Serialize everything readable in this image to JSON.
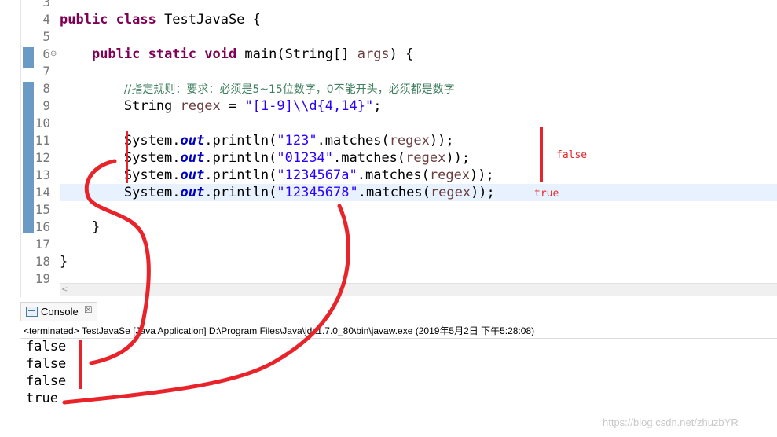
{
  "editor": {
    "lines": [
      {
        "num": "3"
      },
      {
        "num": "4",
        "code": [
          {
            "t": "public class ",
            "c": "kw"
          },
          {
            "t": "TestJavaSe {"
          }
        ]
      },
      {
        "num": "5"
      },
      {
        "num": "6",
        "fold": "⊖",
        "code": [
          {
            "t": "    "
          },
          {
            "t": "public static void ",
            "c": "kw"
          },
          {
            "t": "main(String[] "
          },
          {
            "t": "args",
            "c": "var"
          },
          {
            "t": ") {"
          }
        ]
      },
      {
        "num": "7"
      },
      {
        "num": "8",
        "code": [
          {
            "t": "        "
          },
          {
            "t": "//指定规则：要求：必须是5~15位数字，0不能开头，必须都是数字",
            "c": "cmt"
          }
        ]
      },
      {
        "num": "9",
        "code": [
          {
            "t": "        String "
          },
          {
            "t": "regex",
            "c": "var"
          },
          {
            "t": " = "
          },
          {
            "t": "\"[1-9]\\\\d{4,14}\"",
            "c": "str"
          },
          {
            "t": ";"
          }
        ]
      },
      {
        "num": "10"
      },
      {
        "num": "11",
        "code": [
          {
            "t": "        System."
          },
          {
            "t": "out",
            "c": "fld"
          },
          {
            "t": ".println("
          },
          {
            "t": "\"123\"",
            "c": "str"
          },
          {
            "t": ".matches("
          },
          {
            "t": "regex",
            "c": "var"
          },
          {
            "t": "));"
          }
        ]
      },
      {
        "num": "12",
        "code": [
          {
            "t": "        System."
          },
          {
            "t": "out",
            "c": "fld"
          },
          {
            "t": ".println("
          },
          {
            "t": "\"01234\"",
            "c": "str"
          },
          {
            "t": ".matches("
          },
          {
            "t": "regex",
            "c": "var"
          },
          {
            "t": "));"
          }
        ]
      },
      {
        "num": "13",
        "code": [
          {
            "t": "        System."
          },
          {
            "t": "out",
            "c": "fld"
          },
          {
            "t": ".println("
          },
          {
            "t": "\"1234567a\"",
            "c": "str"
          },
          {
            "t": ".matches("
          },
          {
            "t": "regex",
            "c": "var"
          },
          {
            "t": "));"
          }
        ]
      },
      {
        "num": "14",
        "current": true,
        "code": [
          {
            "t": "        System."
          },
          {
            "t": "out",
            "c": "fld"
          },
          {
            "t": ".println("
          },
          {
            "t": "\"12345678",
            "c": "str"
          },
          {
            "caret": true
          },
          {
            "t": "\"",
            "c": "str"
          },
          {
            "t": ".matches("
          },
          {
            "t": "regex",
            "c": "var"
          },
          {
            "t": "));"
          }
        ]
      },
      {
        "num": "15"
      },
      {
        "num": "16",
        "code": [
          {
            "t": "    }"
          }
        ]
      },
      {
        "num": "17"
      },
      {
        "num": "18",
        "code": [
          {
            "t": "}"
          }
        ]
      },
      {
        "num": "19"
      }
    ]
  },
  "console": {
    "tab_label": "Console",
    "close_glyph": "☒",
    "terminated": "<terminated> TestJavaSe [Java Application] D:\\Program Files\\Java\\jdk1.7.0_80\\bin\\javaw.exe (2019年5月2日 下午5:28:08)",
    "output": [
      "false",
      "false",
      "false",
      "true"
    ]
  },
  "annotations": {
    "false_label": "false",
    "true_label": "true",
    "color": "#e8242a"
  },
  "watermark": "https://blog.csdn.net/zhuzbYR"
}
